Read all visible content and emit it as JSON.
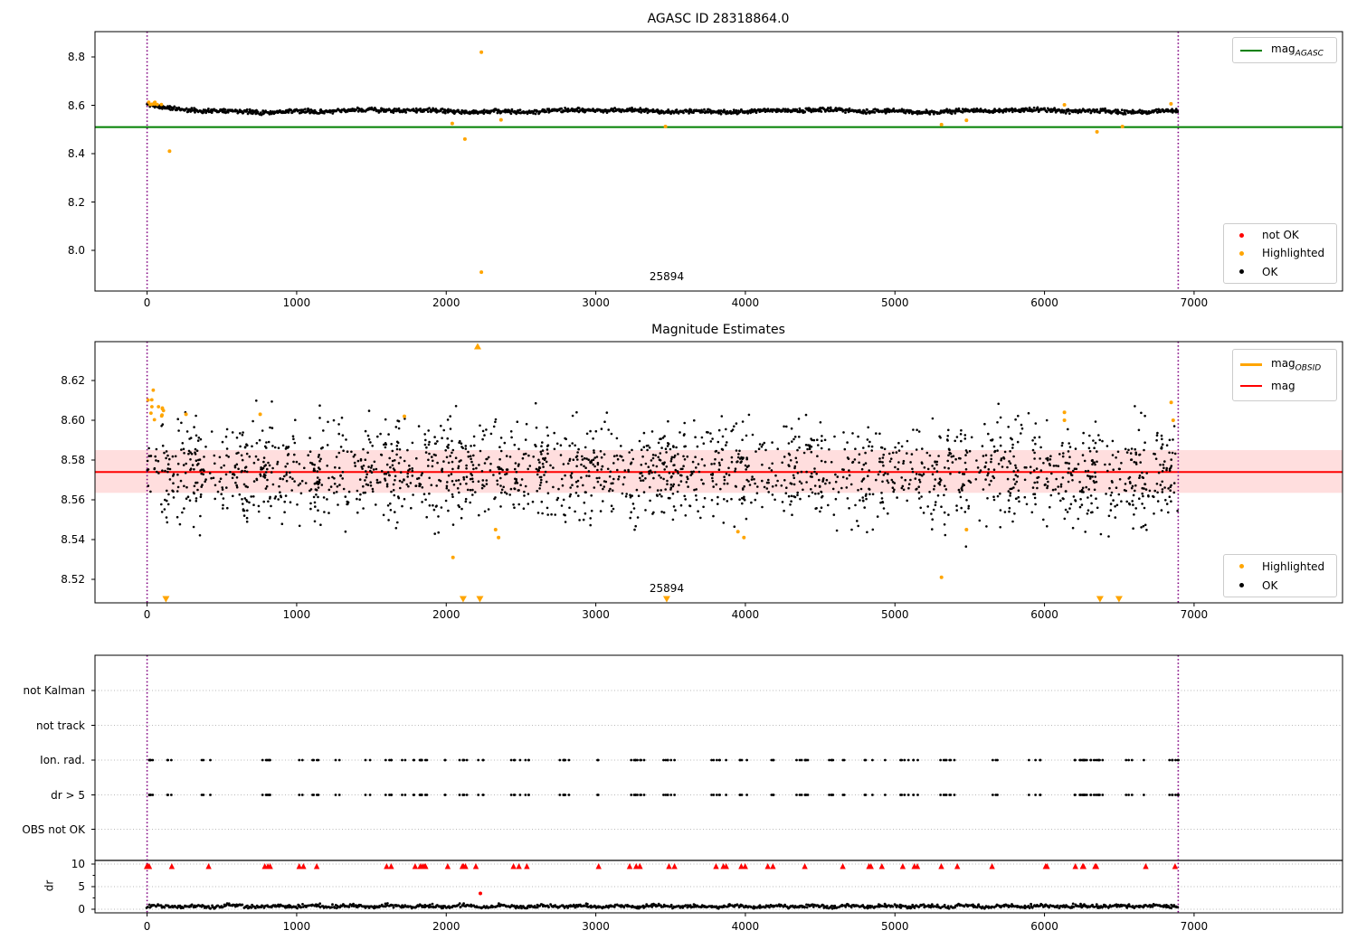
{
  "colors": {
    "ok_point": "#000000",
    "highlight": "#ffa500",
    "not_ok": "#ff0000",
    "agasc_line": "#008000",
    "mag_line": "#ff0000",
    "mag_band": "rgba(255,0,0,0.13)",
    "obsid_vline": "#800080",
    "grid": "#b8b8b8",
    "axis": "#000000"
  },
  "plot1": {
    "title": "AGASC ID 28318864.0",
    "annotation": "25894",
    "yticks": [
      "8.8",
      "8.6",
      "8.4",
      "8.2",
      "8.0"
    ],
    "xticks": [
      "0",
      "1000",
      "2000",
      "3000",
      "4000",
      "5000",
      "6000",
      "7000"
    ],
    "legend_line": {
      "main": "mag",
      "sub": "AGASC"
    },
    "legend_points": [
      {
        "label": "not OK",
        "color": "#ff0000"
      },
      {
        "label": "Highlighted",
        "color": "#ffa500"
      },
      {
        "label": "OK",
        "color": "#000000"
      }
    ]
  },
  "plot2": {
    "title": "Magnitude Estimates",
    "annotation": "25894",
    "yticks": [
      "8.62",
      "8.60",
      "8.58",
      "8.56",
      "8.54",
      "8.52"
    ],
    "xticks": [
      "0",
      "1000",
      "2000",
      "3000",
      "4000",
      "5000",
      "6000",
      "7000"
    ],
    "legend_lines": [
      {
        "main": "mag",
        "sub": "OBSID",
        "color": "#ffa500",
        "thick": 3
      },
      {
        "main": "mag",
        "sub": "",
        "color": "#ff0000",
        "thick": 2
      }
    ],
    "legend_points": [
      {
        "label": "Highlighted",
        "color": "#ffa500"
      },
      {
        "label": "OK",
        "color": "#000000"
      }
    ]
  },
  "plot3": {
    "categories": [
      "not Kalman",
      "not track",
      "Ion. rad.",
      "dr > 5",
      "OBS not OK"
    ],
    "dr_ticks": [
      "10",
      "5",
      "0"
    ],
    "ylabel": "dr",
    "xticks": [
      "0",
      "1000",
      "2000",
      "3000",
      "4000",
      "5000",
      "6000",
      "7000"
    ]
  },
  "chart_data": [
    {
      "type": "scatter",
      "title": "AGASC ID 28318864.0",
      "xlim": [
        -350,
        8000
      ],
      "ylim": [
        7.83,
        8.9
      ],
      "yticks": [
        8.8,
        8.6,
        8.4,
        8.2,
        8.0
      ],
      "xticks": [
        0,
        1000,
        2000,
        3000,
        4000,
        5000,
        6000,
        7000
      ],
      "agasc_mag_line": 8.51,
      "obsid_vlines": [
        0,
        6894
      ],
      "annotation": {
        "text": "25894",
        "x": 3474,
        "y": 7.89
      },
      "ok_band": {
        "x_start": 0,
        "x_end": 6894,
        "n": 1600,
        "base": 8.5765,
        "start_level": 8.6,
        "start_decay": 130,
        "noise": 0.0105,
        "seed": 11
      },
      "highlighted_cluster_near_zero": {
        "x_range": [
          0,
          110
        ],
        "y_range": [
          8.598,
          8.614
        ],
        "n": 8,
        "seed": 21
      },
      "highlighted_points": [
        [
          150,
          8.41
        ],
        [
          2040,
          8.525
        ],
        [
          2125,
          8.46
        ],
        [
          2235,
          8.82
        ],
        [
          2235,
          7.91
        ],
        [
          2366,
          8.54
        ],
        [
          3466,
          8.512
        ],
        [
          5311,
          8.52
        ],
        [
          5478,
          8.538
        ],
        [
          6133,
          8.602
        ],
        [
          6351,
          8.49
        ],
        [
          6521,
          8.512
        ],
        [
          6846,
          8.606
        ]
      ],
      "legend": [
        "mag_AGASC",
        "not OK",
        "Highlighted",
        "OK"
      ]
    },
    {
      "type": "scatter",
      "title": "Magnitude Estimates",
      "xlim": [
        -350,
        8000
      ],
      "ylim": [
        8.508,
        8.6395
      ],
      "yticks": [
        8.62,
        8.6,
        8.58,
        8.56,
        8.54,
        8.52
      ],
      "xticks": [
        0,
        1000,
        2000,
        3000,
        4000,
        5000,
        6000,
        7000
      ],
      "mag_line": 8.574,
      "mag_band": [
        8.5635,
        8.585
      ],
      "obsid_vlines": [
        0,
        6894
      ],
      "annotation": {
        "text": "25894",
        "x": 3474,
        "y": 8.516
      },
      "ok_scatter": {
        "x_start": 0,
        "x_end": 6894,
        "n": 3200,
        "mean": 8.574,
        "sigma": 0.0125,
        "clip_hi": 8.612,
        "seed": 31
      },
      "highlighted_cluster_near_zero": {
        "x_range": [
          0,
          120
        ],
        "y_range": [
          8.596,
          8.616
        ],
        "n": 12,
        "seed": 41
      },
      "highlighted_points": [
        [
          260,
          8.603
        ],
        [
          756,
          8.603
        ],
        [
          1720,
          8.602
        ],
        [
          2045,
          8.531
        ],
        [
          2330,
          8.545
        ],
        [
          2350,
          8.541
        ],
        [
          3950,
          8.544
        ],
        [
          3990,
          8.541
        ],
        [
          5311,
          8.521
        ],
        [
          5478,
          8.545
        ],
        [
          6133,
          8.604
        ],
        [
          6133,
          8.6
        ],
        [
          6847,
          8.609
        ],
        [
          6860,
          8.6
        ]
      ],
      "clipped_high_triangles": [
        2210
      ],
      "clipped_low_triangles": [
        126,
        2113,
        2225,
        3474,
        6371,
        6498
      ],
      "legend": [
        "mag_OBSID",
        "mag",
        "Highlighted",
        "OK"
      ]
    },
    {
      "type": "scatter",
      "title": "flags and dr",
      "xlim": [
        -350,
        8000
      ],
      "categories": [
        "not Kalman",
        "not track",
        "Ion. rad.",
        "dr > 5",
        "OBS not OK"
      ],
      "xticks": [
        0,
        1000,
        2000,
        3000,
        4000,
        5000,
        6000,
        7000
      ],
      "obsid_vlines": [
        0,
        6894
      ],
      "dr_axis": {
        "ticks": [
          10,
          5,
          0
        ],
        "limit_line": 10.8
      },
      "flag_clusters_x": [
        2,
        20,
        141,
        395,
        789,
        819,
        1000,
        1025,
        1121,
        1272,
        1490,
        1617,
        1720,
        1793,
        1811,
        1853,
        1865,
        2010,
        2113,
        2131,
        2222,
        2464,
        2524,
        2766,
        2797,
        3008,
        3250,
        3293,
        3468,
        3504,
        3795,
        3855,
        3988,
        4158,
        4188,
        4369,
        4399,
        4581,
        4641,
        4823,
        4913,
        5065,
        5125,
        5306,
        5349,
        5397,
        5669,
        5911,
        5960,
        5990,
        6226,
        6256,
        6286,
        6347,
        6377,
        6558,
        6685,
        6849,
        6879
      ],
      "flag_rows_with_points": [
        "Ion. rad.",
        "dr > 5"
      ],
      "dr_clipped_red_triangles_at": 10,
      "red_outlier_points": [
        [
          2228,
          3.5
        ]
      ],
      "dr_trace": {
        "x_start": 0,
        "x_end": 6894,
        "n": 1100,
        "mean": 0.6,
        "max": 1.6,
        "seed": 51
      }
    }
  ]
}
